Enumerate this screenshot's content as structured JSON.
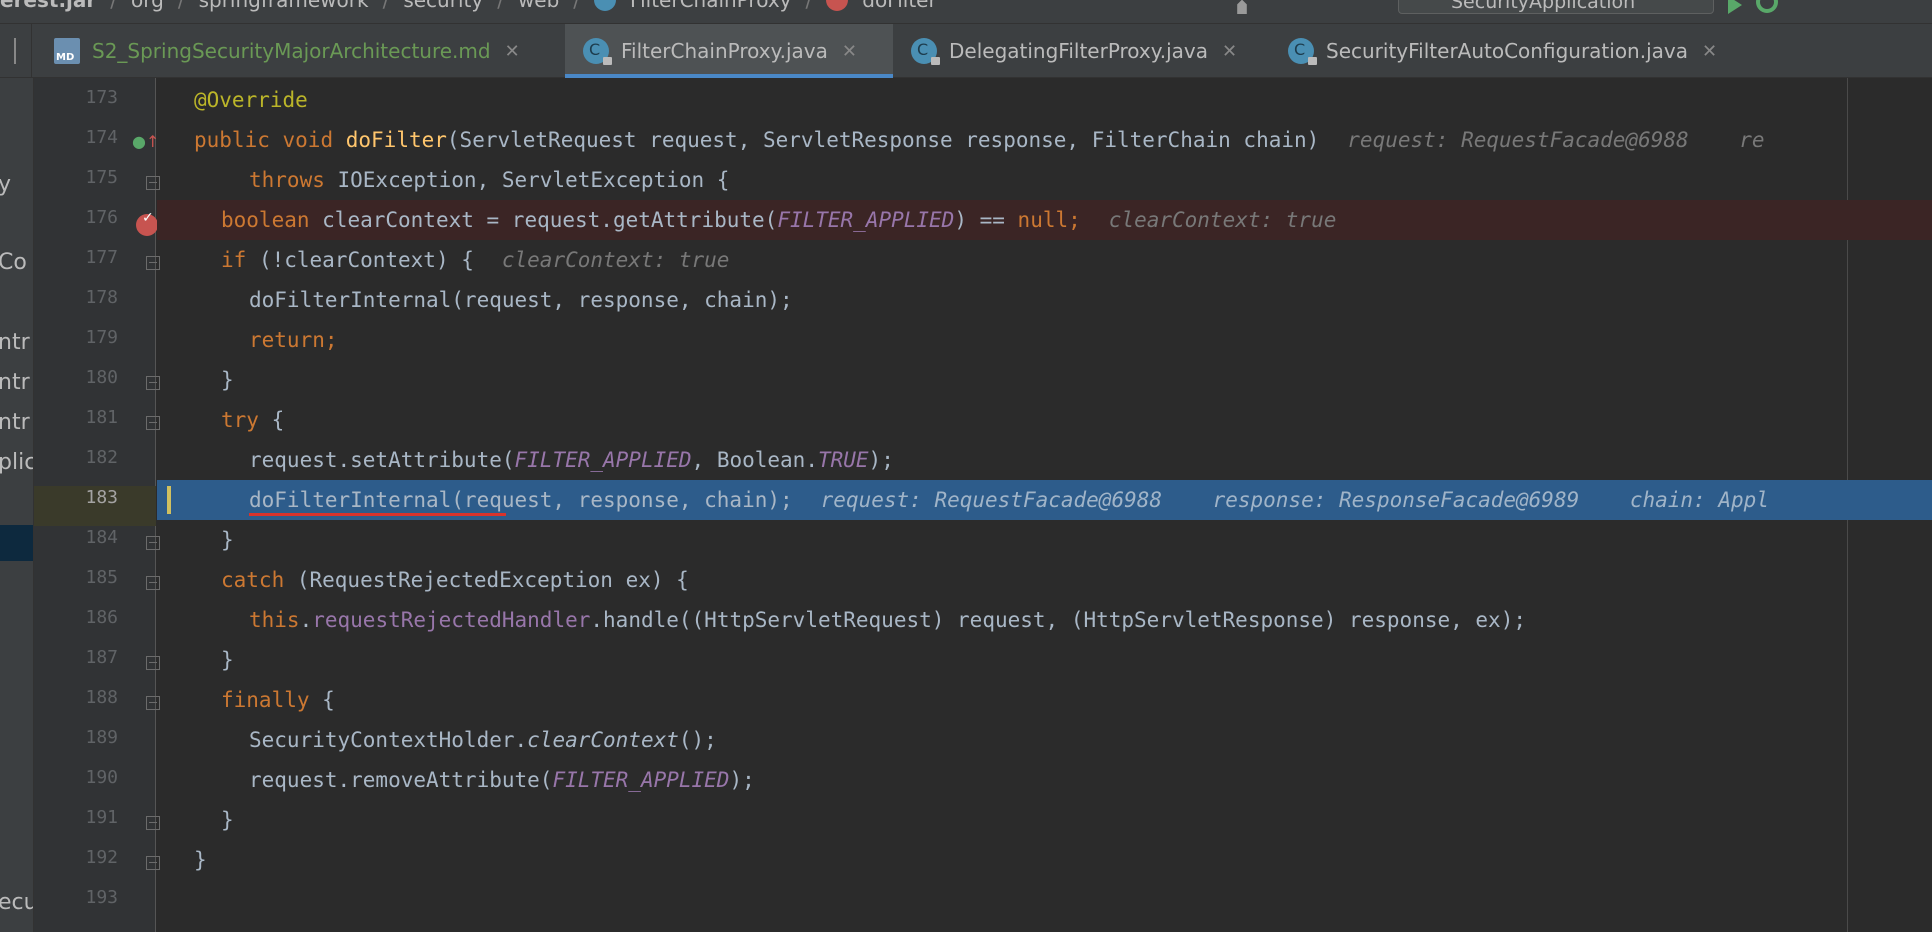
{
  "breadcrumb": {
    "items": [
      "erest.jar",
      "org",
      "springframework",
      "security",
      "web",
      "FilterChainProxy",
      "doFilter"
    ]
  },
  "toolbar": {
    "run_config": "SecurityApplication"
  },
  "tabs": [
    {
      "label": "S2_SpringSecurityMajorArchitecture.md",
      "icon": "markdown-file-icon",
      "active": false
    },
    {
      "label": "FilterChainProxy.java",
      "icon": "java-class-icon",
      "active": true
    },
    {
      "label": "DelegatingFilterProxy.java",
      "icon": "java-class-icon",
      "active": false
    },
    {
      "label": "SecurityFilterAutoConfiguration.java",
      "icon": "java-class-icon",
      "active": false
    }
  ],
  "left_panel": {
    "fragments": [
      "y",
      "Co",
      "ntr",
      "ntr",
      "ntr",
      "plic",
      "ecu"
    ]
  },
  "gutter": {
    "line_numbers": [
      "173",
      "174",
      "175",
      "176",
      "177",
      "178",
      "179",
      "180",
      "181",
      "182",
      "183",
      "184",
      "185",
      "186",
      "187",
      "188",
      "189",
      "190",
      "191",
      "192",
      "193"
    ],
    "current_line": "183"
  },
  "code": {
    "l173_override": "@Override",
    "l174_public": "public",
    "l174_void": "void",
    "l174_name": "doFilter",
    "l174_params": "(ServletRequest request, ServletResponse response, FilterChain chain)",
    "l174_hint": "request: RequestFacade@6988    re",
    "l175_throws": "throws",
    "l175_rest": " IOException, ServletException {",
    "l176_boolean": "boolean",
    "l176_mid": " clearContext = request.getAttribute(",
    "l176_const": "FILTER_APPLIED",
    "l176_eq": ") == ",
    "l176_null": "null",
    "l176_semi": ";",
    "l176_hint": "clearContext: true",
    "l177_if": "if",
    "l177_rest": " (!clearContext) {",
    "l177_hint": "clearContext: true",
    "l178_code": "doFilterInternal(request, response, chain);",
    "l179_return": "return;",
    "l180_brace": "}",
    "l181_try": "try",
    "l181_brace": " {",
    "l182_pre": "request.setAttribute(",
    "l182_const": "FILTER_APPLIED",
    "l182_mid": ", Boolean.",
    "l182_true": "TRUE",
    "l182_end": ");",
    "l183_code": "doFilterInternal(request, response, chain);",
    "l183_hint": "request: RequestFacade@6988    response: ResponseFacade@6989    chain: Appl",
    "l184_brace": "}",
    "l185_catch": "catch",
    "l185_rest": " (RequestRejectedException ex) {",
    "l186_this": "this",
    "l186_dot": ".",
    "l186_field": "requestRejectedHandler",
    "l186_rest": ".handle((HttpServletRequest) request, (HttpServletResponse) response, ex);",
    "l187_brace": "}",
    "l188_finally": "finally",
    "l188_brace": " {",
    "l189_pre": "SecurityContextHolder.",
    "l189_method": "clearContext",
    "l189_end": "();",
    "l190_pre": "request.removeAttribute(",
    "l190_const": "FILTER_APPLIED",
    "l190_end": ");",
    "l191_brace": "}",
    "l192_brace": "}"
  },
  "colors": {
    "editor_bg": "#2b2b2b",
    "keyword": "#cc7832",
    "annotation": "#bbb529",
    "method_decl": "#ffc66d",
    "constant": "#9876aa",
    "execution_line": "#2d5c8b",
    "breakpoint_line": "#3b2525",
    "active_tab_underline": "#4a88c7"
  }
}
